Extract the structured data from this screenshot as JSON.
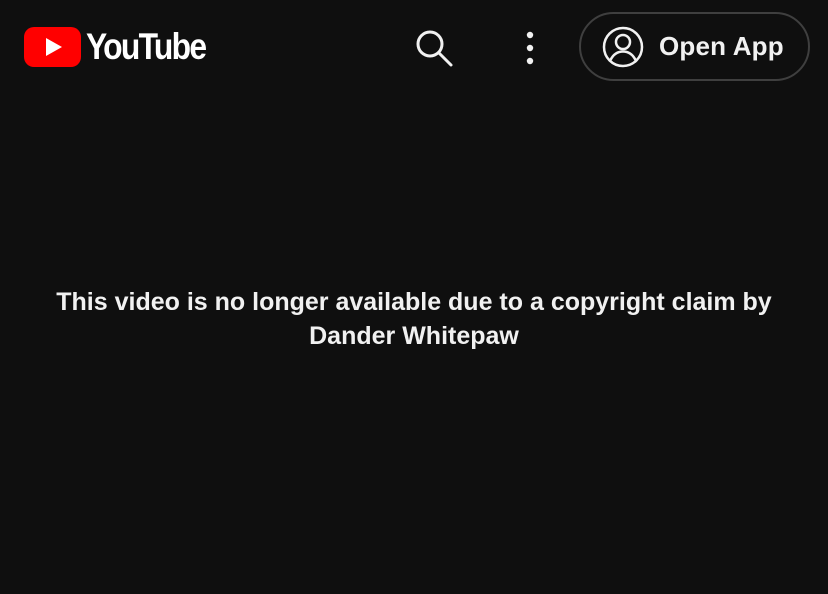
{
  "header": {
    "logo_text": "YouTube",
    "search_icon": "search-icon",
    "menu_icon": "more-vert-icon",
    "open_app": {
      "icon": "account-circle-icon",
      "label": "Open App"
    }
  },
  "main": {
    "message": "This video is no longer available due to a copyright claim by Dander Whitepaw"
  },
  "colors": {
    "background": "#0f0f0f",
    "brand_red": "#ff0000",
    "text": "#f1f1f1",
    "button_border": "#3f3f3f"
  }
}
